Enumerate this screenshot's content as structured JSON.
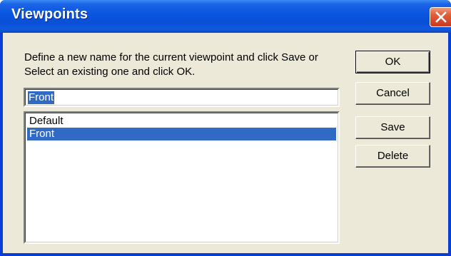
{
  "window": {
    "title": "Viewpoints",
    "close_icon": "close-x-icon"
  },
  "dialog": {
    "instructions": "Define a new name for the current viewpoint and click Save or Select an existing one and click OK.",
    "name_input": {
      "value": "Front"
    },
    "viewpoints_list": {
      "items": [
        "Default",
        "Front"
      ],
      "selected": "Front"
    },
    "buttons": {
      "ok": "OK",
      "cancel": "Cancel",
      "save": "Save",
      "delete": "Delete"
    }
  },
  "colors": {
    "titlebar_blue": "#0a55e0",
    "dialog_face": "#ece9d8",
    "selection_blue": "#316ac5",
    "close_red": "#d6492a"
  }
}
